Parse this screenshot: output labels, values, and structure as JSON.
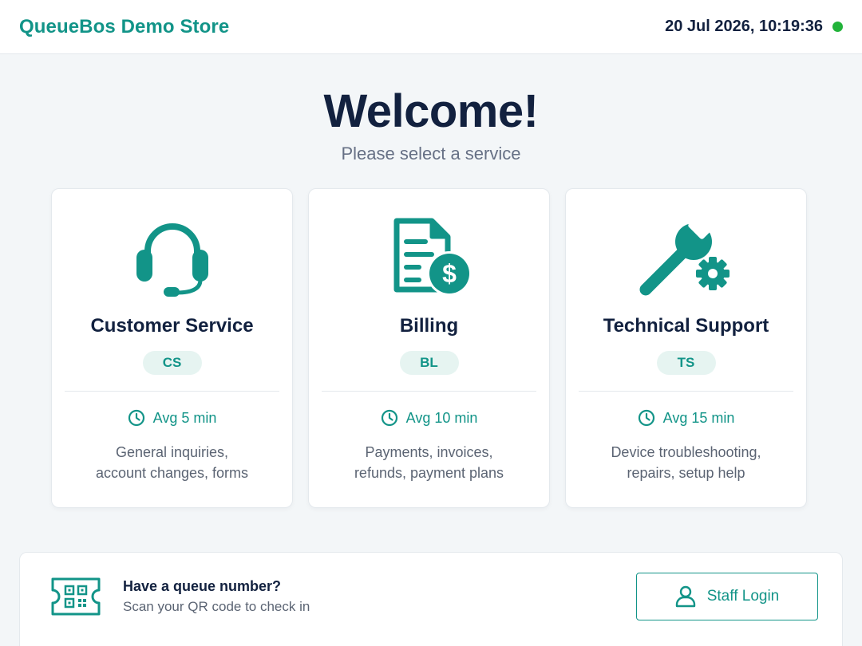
{
  "header": {
    "brand": "QueueBos Demo Store",
    "datetime": "20 Jul 2026, 10:19:36",
    "status_color": "#22b33a"
  },
  "hero": {
    "title": "Welcome!",
    "subtitle": "Please select a service"
  },
  "services": [
    {
      "icon": "headset-icon",
      "title": "Customer Service",
      "code": "CS",
      "wait": "Avg 5 min",
      "desc_line1": "General inquiries,",
      "desc_line2": "account changes, forms"
    },
    {
      "icon": "invoice-dollar-icon",
      "title": "Billing",
      "code": "BL",
      "wait": "Avg 10 min",
      "desc_line1": "Payments, invoices,",
      "desc_line2": "refunds, payment plans"
    },
    {
      "icon": "wrench-gear-icon",
      "title": "Technical Support",
      "code": "TS",
      "wait": "Avg 15 min",
      "desc_line1": "Device troubleshooting,",
      "desc_line2": "repairs, setup help"
    }
  ],
  "checkin": {
    "icon": "qr-ticket-icon",
    "title": "Have a queue number?",
    "subtitle": "Scan your QR code to check in"
  },
  "staff": {
    "icon": "user-icon",
    "label": "Staff Login"
  },
  "colors": {
    "accent": "#129488",
    "text_dark": "#12213f",
    "text_muted": "#5b6473",
    "background": "#f3f6f8"
  }
}
